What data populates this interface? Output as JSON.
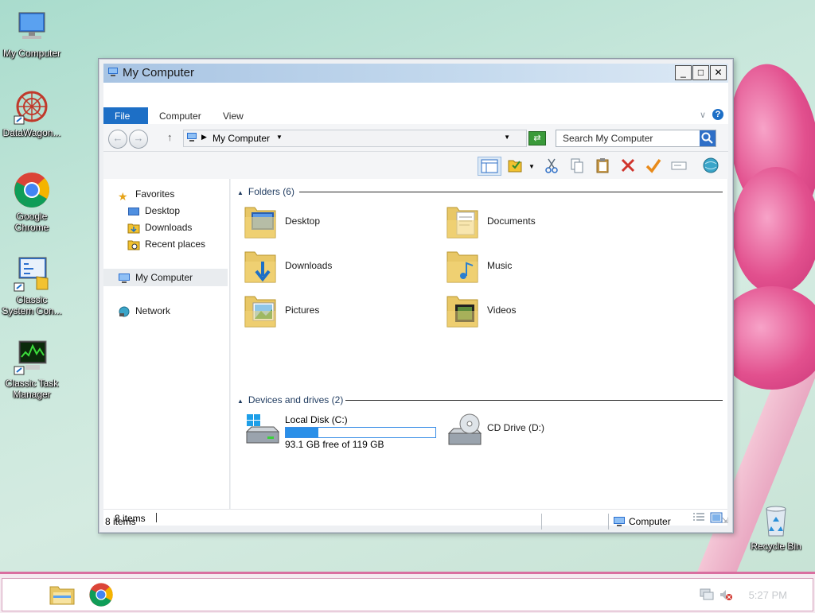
{
  "desktop": {
    "icons": [
      {
        "label": "My Computer"
      },
      {
        "label": "DataWagon..."
      },
      {
        "label": "Google Chrome"
      },
      {
        "label": "Classic System Con..."
      },
      {
        "label": "Classic Task Manager"
      },
      {
        "label": "Recycle Bin"
      }
    ]
  },
  "window": {
    "title": "My Computer",
    "title_icon": "computer-icon",
    "controls": {
      "minimize": "_",
      "maximize": "□",
      "close": "✕"
    },
    "tabs": [
      "File",
      "Computer",
      "View"
    ],
    "address": {
      "label": "My Computer"
    },
    "search": {
      "placeholder": "Search My Computer"
    },
    "accent_color": "#1d6fc6"
  },
  "sidebar": {
    "favorites": {
      "label": "Favorites",
      "items": [
        {
          "label": "Desktop"
        },
        {
          "label": "Downloads"
        },
        {
          "label": "Recent places"
        }
      ]
    },
    "computer": {
      "label": "My Computer"
    },
    "network": {
      "label": "Network"
    }
  },
  "content": {
    "folders": {
      "header": "Folders",
      "count": "(6)",
      "items": [
        {
          "label": "Desktop"
        },
        {
          "label": "Documents"
        },
        {
          "label": "Downloads"
        },
        {
          "label": "Music"
        },
        {
          "label": "Pictures"
        },
        {
          "label": "Videos"
        }
      ]
    },
    "drives": {
      "header": "Devices and drives",
      "count": "(2)",
      "items": [
        {
          "label": "Local Disk (C:)",
          "free": "93.1 GB free of 119 GB",
          "used_fraction": 0.22
        },
        {
          "label": "CD Drive (D:)"
        }
      ]
    }
  },
  "status": {
    "items_count": "8 items",
    "bottom_left": "8 items",
    "bottom_right": "Computer"
  },
  "taskbar": {
    "clock": "5:27 PM"
  }
}
